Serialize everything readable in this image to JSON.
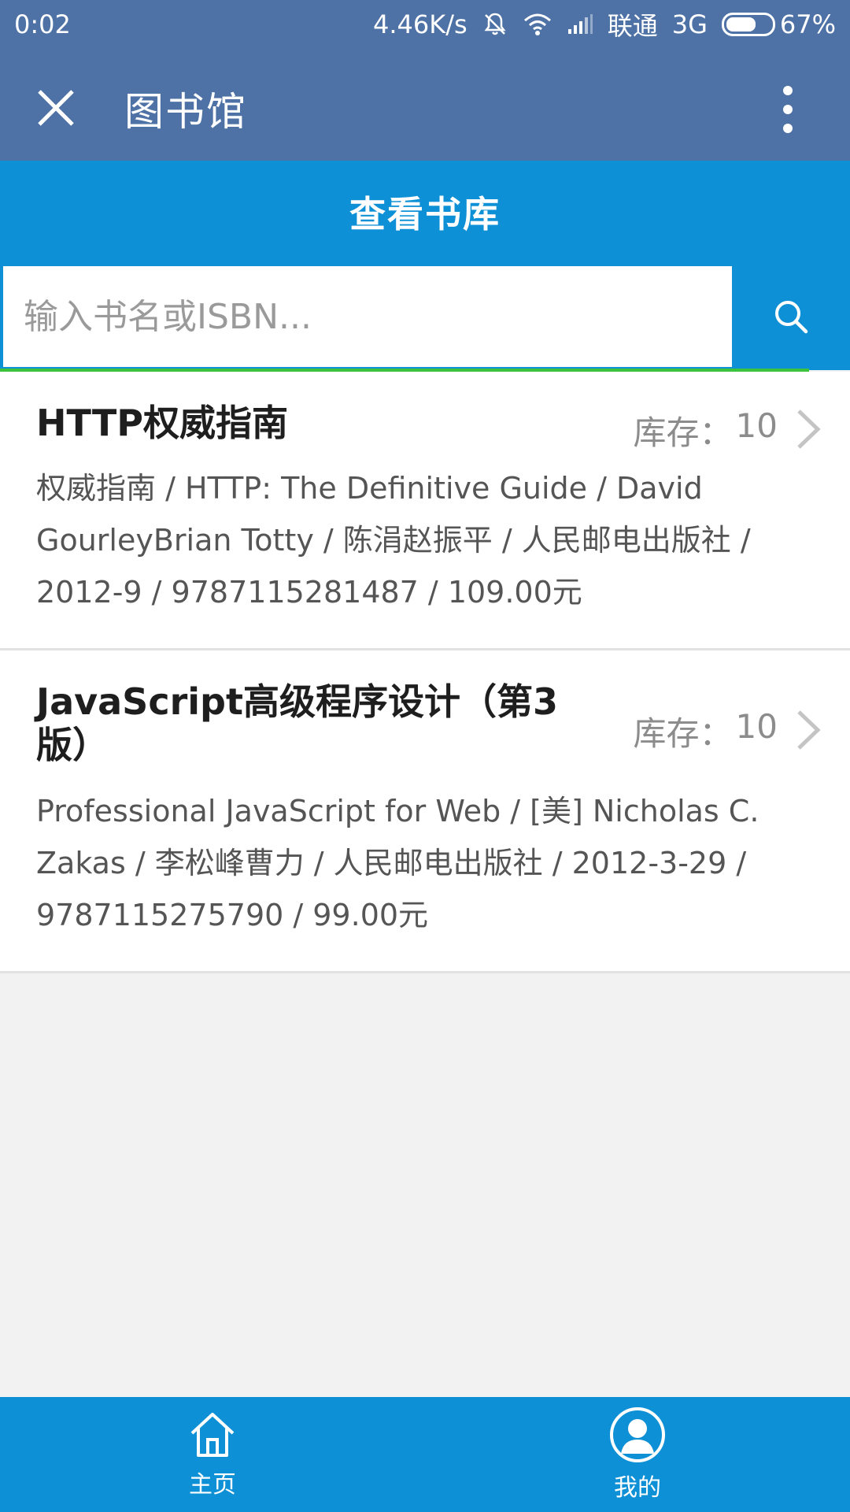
{
  "status_bar": {
    "time": "0:02",
    "speed": "4.46K/s",
    "carrier": "联通",
    "network": "3G",
    "battery": "67%",
    "battery_level": 0.67
  },
  "app_bar": {
    "title": "图书馆"
  },
  "header": {
    "title": "查看书库"
  },
  "search": {
    "placeholder": "输入书名或ISBN...",
    "value": ""
  },
  "books": [
    {
      "title": "HTTP权威指南",
      "stock_label": "库存：",
      "stock_value": "10",
      "meta": "权威指南 / HTTP: The Definitive Guide / David GourleyBrian Totty / 陈涓赵振平 / 人民邮电出版社 / 2012-9 / 9787115281487 / 109.00元"
    },
    {
      "title": "JavaScript高级程序设计（第3版）",
      "stock_label": "库存：",
      "stock_value": "10",
      "meta": "Professional JavaScript for Web / [美] Nicholas C. Zakas / 李松峰曹力 / 人民邮电出版社 / 2012-3-29 / 9787115275790 / 99.00元"
    }
  ],
  "bottom_nav": {
    "items": [
      {
        "label": "主页",
        "icon": "home-icon"
      },
      {
        "label": "我的",
        "icon": "user-icon"
      }
    ]
  },
  "colors": {
    "app_bar": "#4e72a6",
    "accent": "#0e90d6",
    "progress": "#3cc23c",
    "background": "#f2f2f2"
  }
}
